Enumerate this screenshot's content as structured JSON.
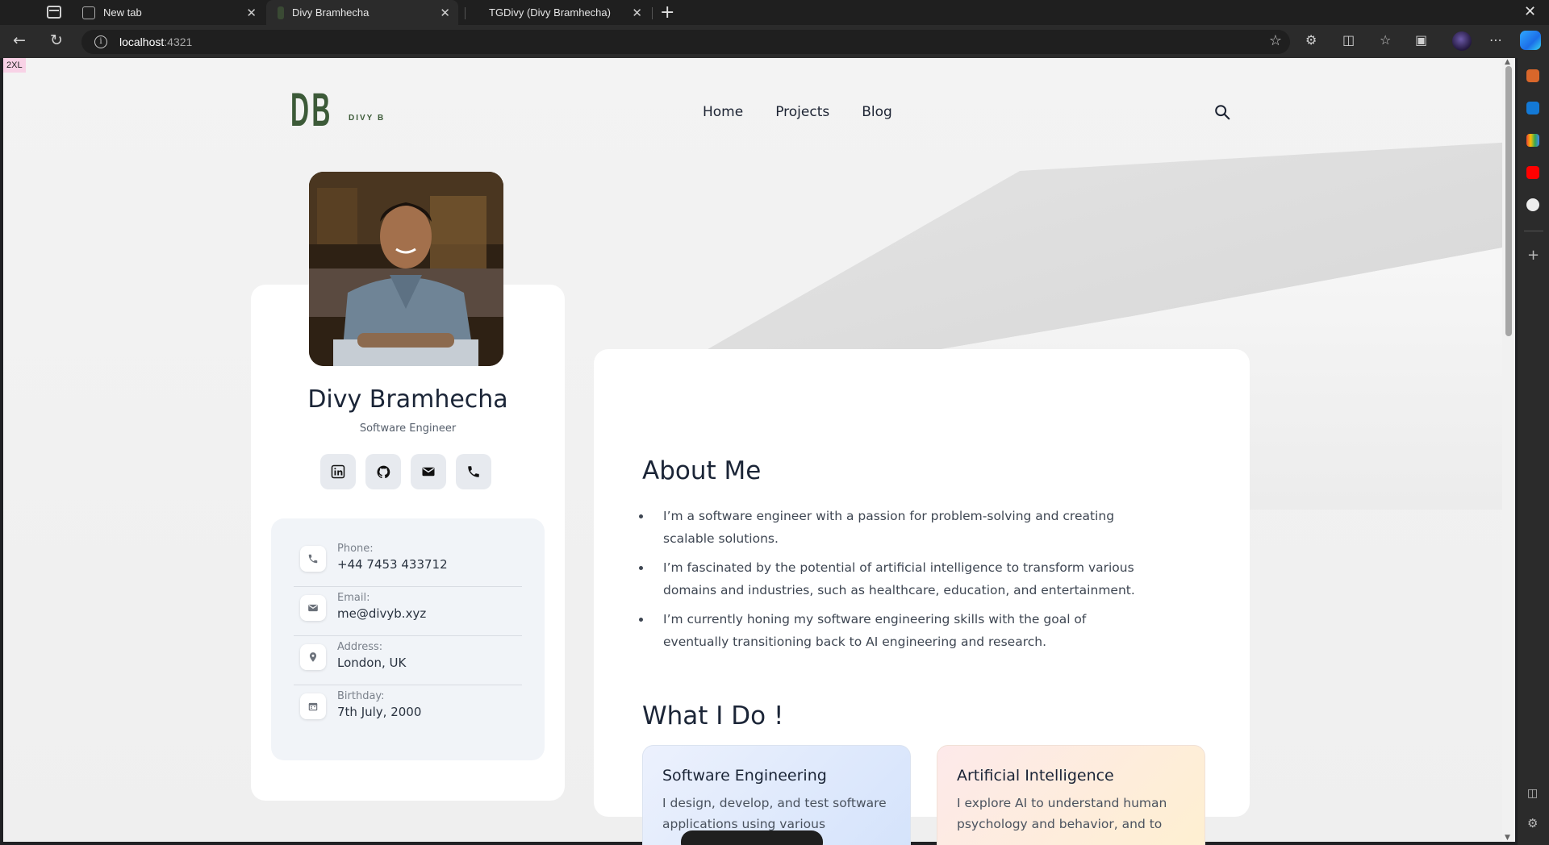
{
  "browser": {
    "tabs": [
      {
        "title": "New tab"
      },
      {
        "title": "Divy Bramhecha"
      },
      {
        "title": "TGDivy (Divy Bramhecha)"
      }
    ],
    "url_host": "localhost",
    "url_port": ":4321"
  },
  "breakpoint_badge": "2XL",
  "site": {
    "logo_big": "DB",
    "logo_small": "DIVY B",
    "nav": [
      "Home",
      "Projects",
      "Blog"
    ]
  },
  "profile": {
    "name": "Divy Bramhecha",
    "role": "Software Engineer",
    "contacts": [
      {
        "label": "Phone:",
        "value": "+44 7453 433712",
        "icon": "phone-icon"
      },
      {
        "label": "Email:",
        "value": "me@divyb.xyz",
        "icon": "mail-icon"
      },
      {
        "label": "Address:",
        "value": "London, UK",
        "icon": "location-pin-icon"
      },
      {
        "label": "Birthday:",
        "value": "7th July, 2000",
        "icon": "calendar-icon"
      }
    ]
  },
  "about": {
    "title": "About Me",
    "points": [
      "I’m a software engineer with a passion for problem-solving and creating scalable solutions.",
      "I’m fascinated by the potential of artificial intelligence to transform various domains and industries, such as healthcare, education, and entertainment.",
      "I’m currently honing my software engineering skills with the goal of eventually transitioning back to AI engineering and research."
    ]
  },
  "what_i_do": {
    "title": "What I Do !",
    "services": [
      {
        "title": "Software Engineering",
        "desc": "I design, develop, and test software applications using various"
      },
      {
        "title": "Artificial Intelligence",
        "desc": "I explore AI to understand human psychology and behavior, and to"
      }
    ]
  },
  "colors": {
    "logo": "#3c5a38",
    "heading": "#1b2537",
    "card_bg": "#ffffff",
    "page_bg": "#f0f0f0"
  }
}
